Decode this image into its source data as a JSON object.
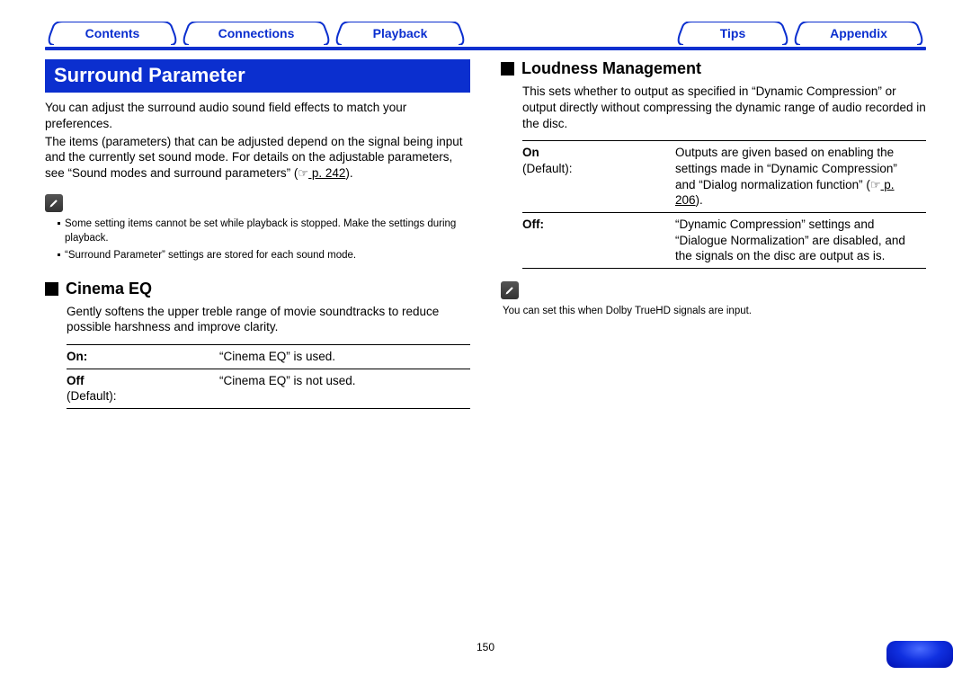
{
  "tabs": {
    "contents": "Contents",
    "connections": "Connections",
    "playback": "Playback",
    "tips": "Tips",
    "appendix": "Appendix"
  },
  "left": {
    "title": "Surround Parameter",
    "intro1": "You can adjust the surround audio sound field effects to match your preferences.",
    "intro2a": "The items (parameters) that can be adjusted depend on the signal being input and the currently set sound mode. For details on the adjustable parameters, see “Sound modes and surround parameters” (",
    "intro2_link": " p. 242",
    "intro2b": ").",
    "notes": [
      "Some setting items cannot be set while playback is stopped. Make the settings during playback.",
      "“Surround Parameter” settings are stored for each sound mode."
    ],
    "cinema": {
      "heading": "Cinema EQ",
      "body": "Gently softens the upper treble range of movie soundtracks to reduce possible harshness and improve clarity.",
      "rows": [
        {
          "k1": "On:",
          "k2": "",
          "desc": "“Cinema EQ” is used."
        },
        {
          "k1": "Off",
          "k2": "(Default):",
          "desc": "“Cinema EQ” is not used."
        }
      ]
    }
  },
  "right": {
    "heading": "Loudness Management",
    "body": "This sets whether to output as specified in “Dynamic Compression” or output directly without compressing the dynamic range of audio recorded in the disc.",
    "rows": [
      {
        "k1": "On",
        "k2": "(Default):",
        "desc_a": "Outputs are given based on enabling the settings made in “Dynamic Compression” and “Dialog normalization function” (",
        "link": " p. 206",
        "desc_b": ")."
      },
      {
        "k1": "Off:",
        "k2": "",
        "desc": "“Dynamic Compression” settings and “Dialogue Normalization” are disabled, and the signals on the disc are output as is."
      }
    ],
    "note": "You can set this when Dolby TrueHD signals are input."
  },
  "page_number": "150"
}
